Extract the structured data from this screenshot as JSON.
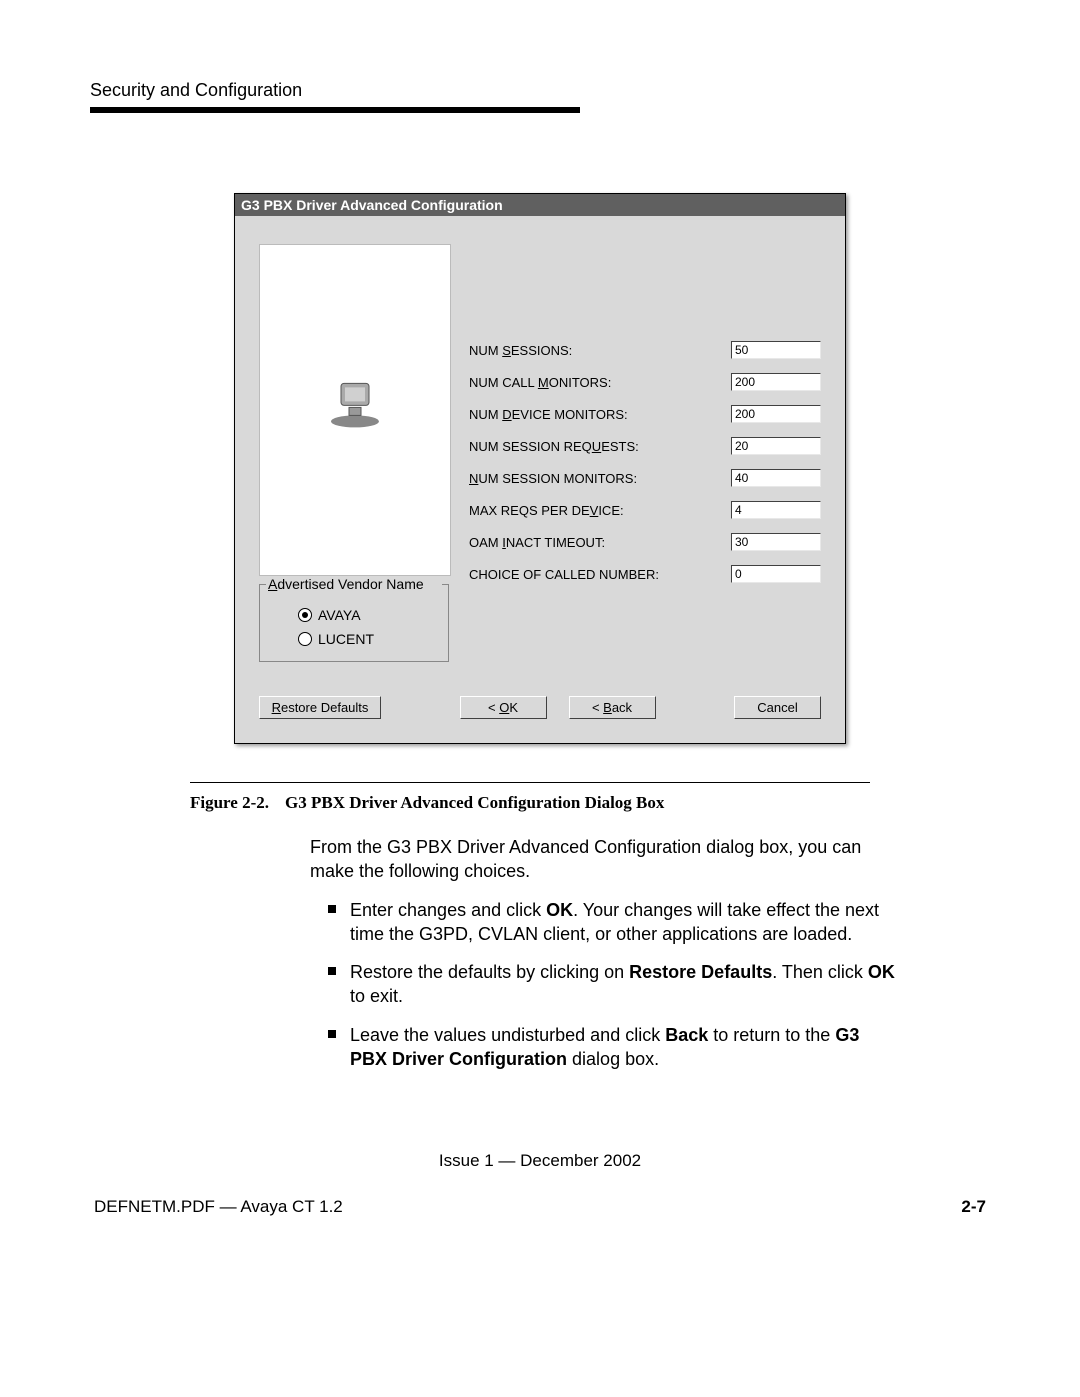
{
  "header": {
    "section_title": "Security and Configuration"
  },
  "dialog": {
    "title": "G3 PBX Driver Advanced Configuration",
    "fields": [
      {
        "label_pre": "NUM ",
        "label_u": "S",
        "label_post": "ESSIONS:",
        "value": "50"
      },
      {
        "label_pre": "NUM CALL ",
        "label_u": "M",
        "label_post": "ONITORS:",
        "value": "200"
      },
      {
        "label_pre": "NUM ",
        "label_u": "D",
        "label_post": "EVICE MONITORS:",
        "value": "200"
      },
      {
        "label_pre": "NUM SESSION REQ",
        "label_u": "U",
        "label_post": "ESTS:",
        "value": "20"
      },
      {
        "label_pre": "",
        "label_u": "N",
        "label_post": "UM SESSION MONITORS:",
        "value": "40"
      },
      {
        "label_pre": "MAX REQS PER DE",
        "label_u": "V",
        "label_post": "ICE:",
        "value": "4"
      },
      {
        "label_pre": "OAM ",
        "label_u": "I",
        "label_post": "NACT TIMEOUT:",
        "value": "30"
      },
      {
        "label_pre": "CHOICE OF CALLED NUMBER:",
        "label_u": "",
        "label_post": "",
        "value": "0"
      }
    ],
    "vendor_group": {
      "legend_pre": "",
      "legend_u": "A",
      "legend_post": "dvertised Vendor Name",
      "options": [
        {
          "label": "AVAYA",
          "selected": true
        },
        {
          "label": "LUCENT",
          "selected": false
        }
      ]
    },
    "buttons": {
      "restore_pre": "",
      "restore_u": "R",
      "restore_post": "estore Defaults",
      "ok_pre": "< ",
      "ok_u": "O",
      "ok_post": "K",
      "back_pre": "< ",
      "back_u": "B",
      "back_post": "ack",
      "cancel": "Cancel"
    }
  },
  "caption": {
    "number": "Figure 2-2.",
    "title": "G3 PBX Driver Advanced Configuration Dialog Box"
  },
  "body": {
    "intro": "From the G3 PBX Driver Advanced Configuration dialog box, you can make the following choices.",
    "bullets": [
      {
        "parts": [
          "Enter changes and click ",
          "OK",
          ". Your changes will take effect the next time the G3PD, CVLAN client, or other applications are loaded."
        ]
      },
      {
        "parts": [
          "Restore the defaults by clicking on ",
          "Restore Defaults",
          ". Then click ",
          "OK",
          " to exit."
        ]
      },
      {
        "parts": [
          "Leave the values undisturbed and click ",
          "Back",
          " to return to the ",
          "G3 PBX Driver Configuration",
          " dialog box."
        ]
      }
    ]
  },
  "footer": {
    "issue": "Issue 1 — December 2002",
    "doc": "DEFNETM.PDF — Avaya CT 1.2",
    "page": "2-7"
  }
}
